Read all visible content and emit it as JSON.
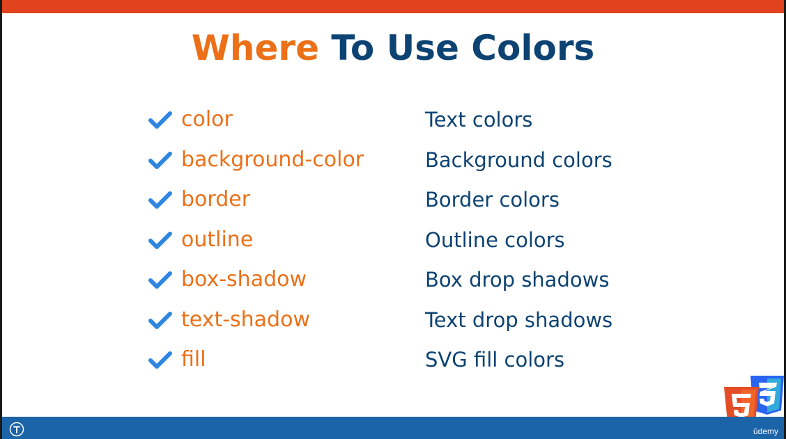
{
  "slide": {
    "title_part1": "Where",
    "title_part2": " To Use Colors"
  },
  "rows": [
    {
      "property": "color",
      "description": "Text colors"
    },
    {
      "property": "background-color",
      "description": "Background colors"
    },
    {
      "property": "border",
      "description": "Border colors"
    },
    {
      "property": "outline",
      "description": "Outline colors"
    },
    {
      "property": "box-shadow",
      "description": "Box drop shadows"
    },
    {
      "property": "text-shadow",
      "description": "Text drop shadows"
    },
    {
      "property": "fill",
      "description": "SVG fill colors"
    }
  ],
  "footer": {
    "brand": "ûdemy",
    "logos": [
      "html5-logo",
      "css3-logo"
    ],
    "player_icon": "timer-icon"
  },
  "colors": {
    "top_bar": "#e0431e",
    "bottom_bar": "#1c64a8",
    "accent_orange": "#ec7018",
    "navy": "#0d4373",
    "check_blue": "#2f86e0"
  }
}
